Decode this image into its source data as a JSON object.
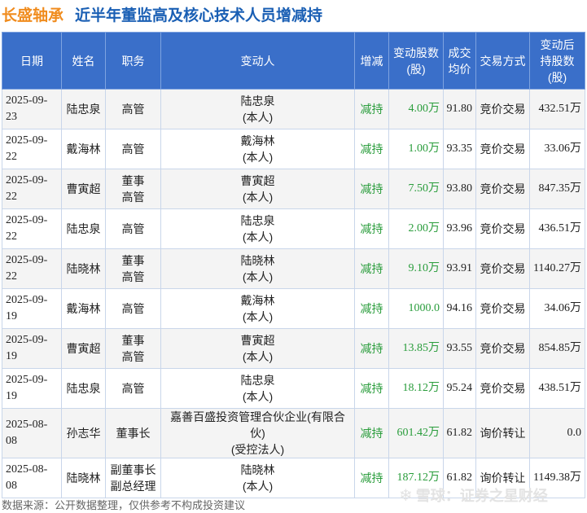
{
  "header": {
    "company": "长盛轴承",
    "title": "近半年董监高及核心技术人员增减持"
  },
  "table": {
    "columns": [
      "日期",
      "姓名",
      "职务",
      "变动人",
      "增减",
      "变动股数\n(股)",
      "成交\n均价",
      "交易方式",
      "变动后\n持股数\n(股)"
    ],
    "rows": [
      {
        "date": "2025-09-23",
        "name": "陆忠泉",
        "position": "高管",
        "person": "陆忠泉\n(本人)",
        "direction": "减持",
        "shares": "4.00万",
        "price": "91.80",
        "method": "竞价交易",
        "holding": "432.51万"
      },
      {
        "date": "2025-09-22",
        "name": "戴海林",
        "position": "高管",
        "person": "戴海林\n(本人)",
        "direction": "减持",
        "shares": "1.00万",
        "price": "93.35",
        "method": "竞价交易",
        "holding": "33.06万"
      },
      {
        "date": "2025-09-22",
        "name": "曹寅超",
        "position": "董事\n高管",
        "person": "曹寅超\n(本人)",
        "direction": "减持",
        "shares": "7.50万",
        "price": "93.80",
        "method": "竞价交易",
        "holding": "847.35万"
      },
      {
        "date": "2025-09-22",
        "name": "陆忠泉",
        "position": "高管",
        "person": "陆忠泉\n(本人)",
        "direction": "减持",
        "shares": "2.00万",
        "price": "93.96",
        "method": "竞价交易",
        "holding": "436.51万"
      },
      {
        "date": "2025-09-22",
        "name": "陆晓林",
        "position": "董事\n高管",
        "person": "陆晓林\n(本人)",
        "direction": "减持",
        "shares": "9.10万",
        "price": "93.91",
        "method": "竞价交易",
        "holding": "1140.27万"
      },
      {
        "date": "2025-09-19",
        "name": "戴海林",
        "position": "高管",
        "person": "戴海林\n(本人)",
        "direction": "减持",
        "shares": "1000.0",
        "price": "94.16",
        "method": "竞价交易",
        "holding": "34.06万"
      },
      {
        "date": "2025-09-19",
        "name": "曹寅超",
        "position": "董事\n高管",
        "person": "曹寅超\n(本人)",
        "direction": "减持",
        "shares": "13.85万",
        "price": "93.55",
        "method": "竞价交易",
        "holding": "854.85万"
      },
      {
        "date": "2025-09-19",
        "name": "陆忠泉",
        "position": "高管",
        "person": "陆忠泉\n(本人)",
        "direction": "减持",
        "shares": "18.12万",
        "price": "95.24",
        "method": "竞价交易",
        "holding": "438.51万"
      },
      {
        "date": "2025-08-08",
        "name": "孙志华",
        "position": "董事长",
        "person": "嘉善百盛投资管理合伙企业(有限合伙)\n(受控法人)",
        "direction": "减持",
        "shares": "601.42万",
        "price": "61.82",
        "method": "询价转让",
        "holding": "0.0"
      },
      {
        "date": "2025-08-08",
        "name": "陆晓林",
        "position": "副董事长\n副总经理",
        "person": "陆晓林\n(本人)",
        "direction": "减持",
        "shares": "187.12万",
        "price": "61.82",
        "method": "询价转让",
        "holding": "1149.38万"
      }
    ]
  },
  "footer": {
    "source": "数据来源：公开数据整理，仅供参考不构成投资建议",
    "logo_text": "雪球：证券之星财经"
  },
  "watermark": {
    "text": "证券之星"
  },
  "colors": {
    "header_bg": "#3a6fc9",
    "title_blue": "#1a5fb4",
    "company_orange": "#f08c1e",
    "decrease_green": "#2a9d3c"
  }
}
